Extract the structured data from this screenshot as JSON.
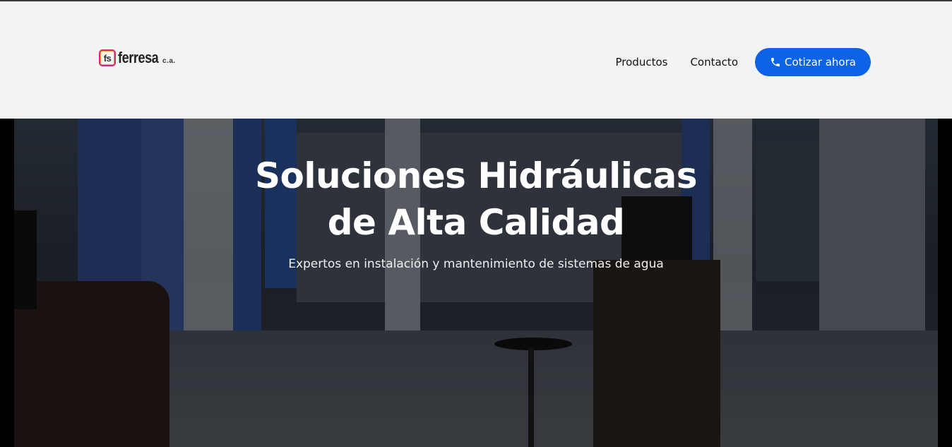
{
  "brand": {
    "mark": "fs",
    "name": "ferresa",
    "suffix": "c.a."
  },
  "nav": {
    "items": [
      {
        "label": "Productos"
      },
      {
        "label": "Contacto"
      }
    ],
    "cta_label": "Cotizar ahora",
    "cta_icon": "phone-icon"
  },
  "hero": {
    "title_line1": "Soluciones Hidráulicas",
    "title_line2": "de Alta Calidad",
    "subtitle": "Expertos en instalación y mantenimiento de sistemas de agua"
  },
  "colors": {
    "accent": "#0d62e6",
    "header_bg": "#f3f3f3",
    "hero_text": "#ffffff"
  }
}
